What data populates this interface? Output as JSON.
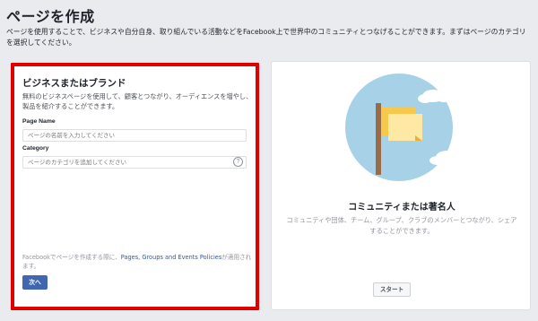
{
  "page": {
    "title": "ページを作成",
    "description": "ページを使用することで、ビジネスや自分自身、取り組んでいる活動などをFacebook上で世界中のコミュニティとつなげることができます。まずはページのカテゴリを選択してください。"
  },
  "business_card": {
    "title": "ビジネスまたはブランド",
    "description": "無料のビジネスページを使用して、顧客とつながり、オーディエンスを増やし、製品を紹介することができます。",
    "page_name_label": "Page Name",
    "page_name_placeholder": "ページの名前を入力してください",
    "category_label": "Category",
    "category_placeholder": "ページのカテゴリを追加してください",
    "help_icon": "?",
    "policy_prefix": "Facebookでページを作成する際に、",
    "policy_link": "Pages, Groups and Events Policies",
    "policy_suffix": "が適用されます。",
    "next_button": "次へ",
    "highlight_color": "#e00000"
  },
  "community_card": {
    "title": "コミュニティまたは著名人",
    "description": "コミュニティや団体、チーム、グループ、クラブのメンバーとつながり、シェアすることができます。",
    "start_button": "スタート",
    "illustration": "flag-illustration"
  }
}
